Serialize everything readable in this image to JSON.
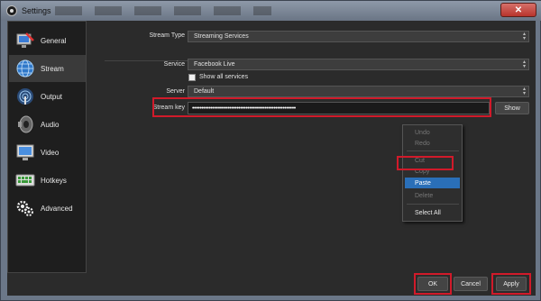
{
  "window": {
    "title": "Settings",
    "close_glyph": "✕"
  },
  "sidebar": {
    "items": [
      {
        "label": "General",
        "icon": "monitor-wrench-icon"
      },
      {
        "label": "Stream",
        "icon": "globe-icon"
      },
      {
        "label": "Output",
        "icon": "antenna-icon"
      },
      {
        "label": "Audio",
        "icon": "speaker-icon"
      },
      {
        "label": "Video",
        "icon": "monitor-icon"
      },
      {
        "label": "Hotkeys",
        "icon": "keyboard-icon"
      },
      {
        "label": "Advanced",
        "icon": "gears-icon"
      }
    ],
    "active_index": 1
  },
  "stream": {
    "stream_type_label": "Stream Type",
    "stream_type_value": "Streaming Services",
    "service_label": "Service",
    "service_value": "Facebook Live",
    "show_all_label": "Show all services",
    "server_label": "Server",
    "server_value": "Default",
    "stream_key_label": "Stream key",
    "stream_key_value": "••••••••••••••••••••••••••••••••••••••••••••••••••••••••",
    "show_button": "Show"
  },
  "context_menu": {
    "items": [
      {
        "label": "Undo",
        "state": "disabled"
      },
      {
        "label": "Redo",
        "state": "disabled"
      },
      {
        "label": "Cut",
        "state": "disabled"
      },
      {
        "label": "Copy",
        "state": "disabled"
      },
      {
        "label": "Paste",
        "state": "selected"
      },
      {
        "label": "Delete",
        "state": "disabled"
      },
      {
        "label": "Select All",
        "state": "enabled"
      }
    ]
  },
  "footer": {
    "ok": "OK",
    "cancel": "Cancel",
    "apply": "Apply"
  },
  "colors": {
    "highlight": "#d11a2a",
    "selection": "#2a6fb8",
    "panel": "#2b2b2b",
    "sidebar": "#1e1e1e"
  }
}
